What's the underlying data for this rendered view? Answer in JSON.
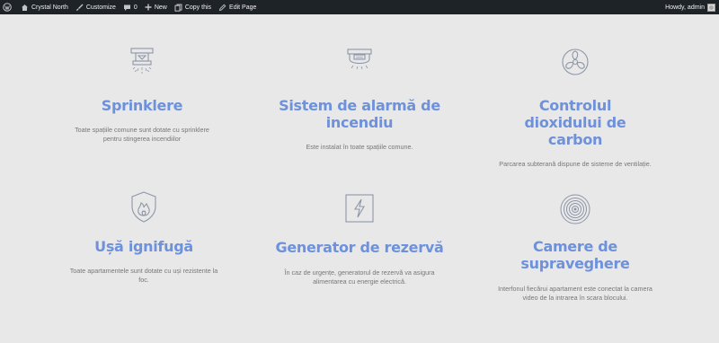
{
  "admin_bar": {
    "site_name": "Crystal North",
    "customize": "Customize",
    "comments_count": "0",
    "new": "New",
    "copy": "Copy this",
    "edit_page": "Edit Page",
    "greeting": "Howdy, admin"
  },
  "colors": {
    "accent": "#6e91dc",
    "icon_stroke": "#8d96a8",
    "admin_bar": "#1d2327",
    "background": "#e8e8e8"
  },
  "features": [
    {
      "icon": "sprinkler-icon",
      "title": "Sprinklere",
      "description": "Toate spațiile comune sunt dotate cu sprinklere pentru stingerea incendiilor"
    },
    {
      "icon": "smoke-alarm-icon",
      "title": "Sistem de alarmă de incendiu",
      "description": "Este instalat în toate spațiile comune."
    },
    {
      "icon": "fan-icon",
      "title": "Controlul dioxidului de carbon",
      "description": "Parcarea subterană dispune de sisteme de ventilație."
    },
    {
      "icon": "fire-shield-icon",
      "title": "Ușă ignifugă",
      "description": "Toate apartamentele sunt dotate cu uși rezistente la foc."
    },
    {
      "icon": "lightning-icon",
      "title": "Generator de rezervă",
      "description": "În caz de urgențe, generatorul de rezervă va asigura alimentarea cu energie electrică."
    },
    {
      "icon": "camera-icon",
      "title": "Camere de supraveghere",
      "description": "Interfonul fiecărui apartament este conectat la camera video de la intrarea în scara blocului."
    }
  ]
}
